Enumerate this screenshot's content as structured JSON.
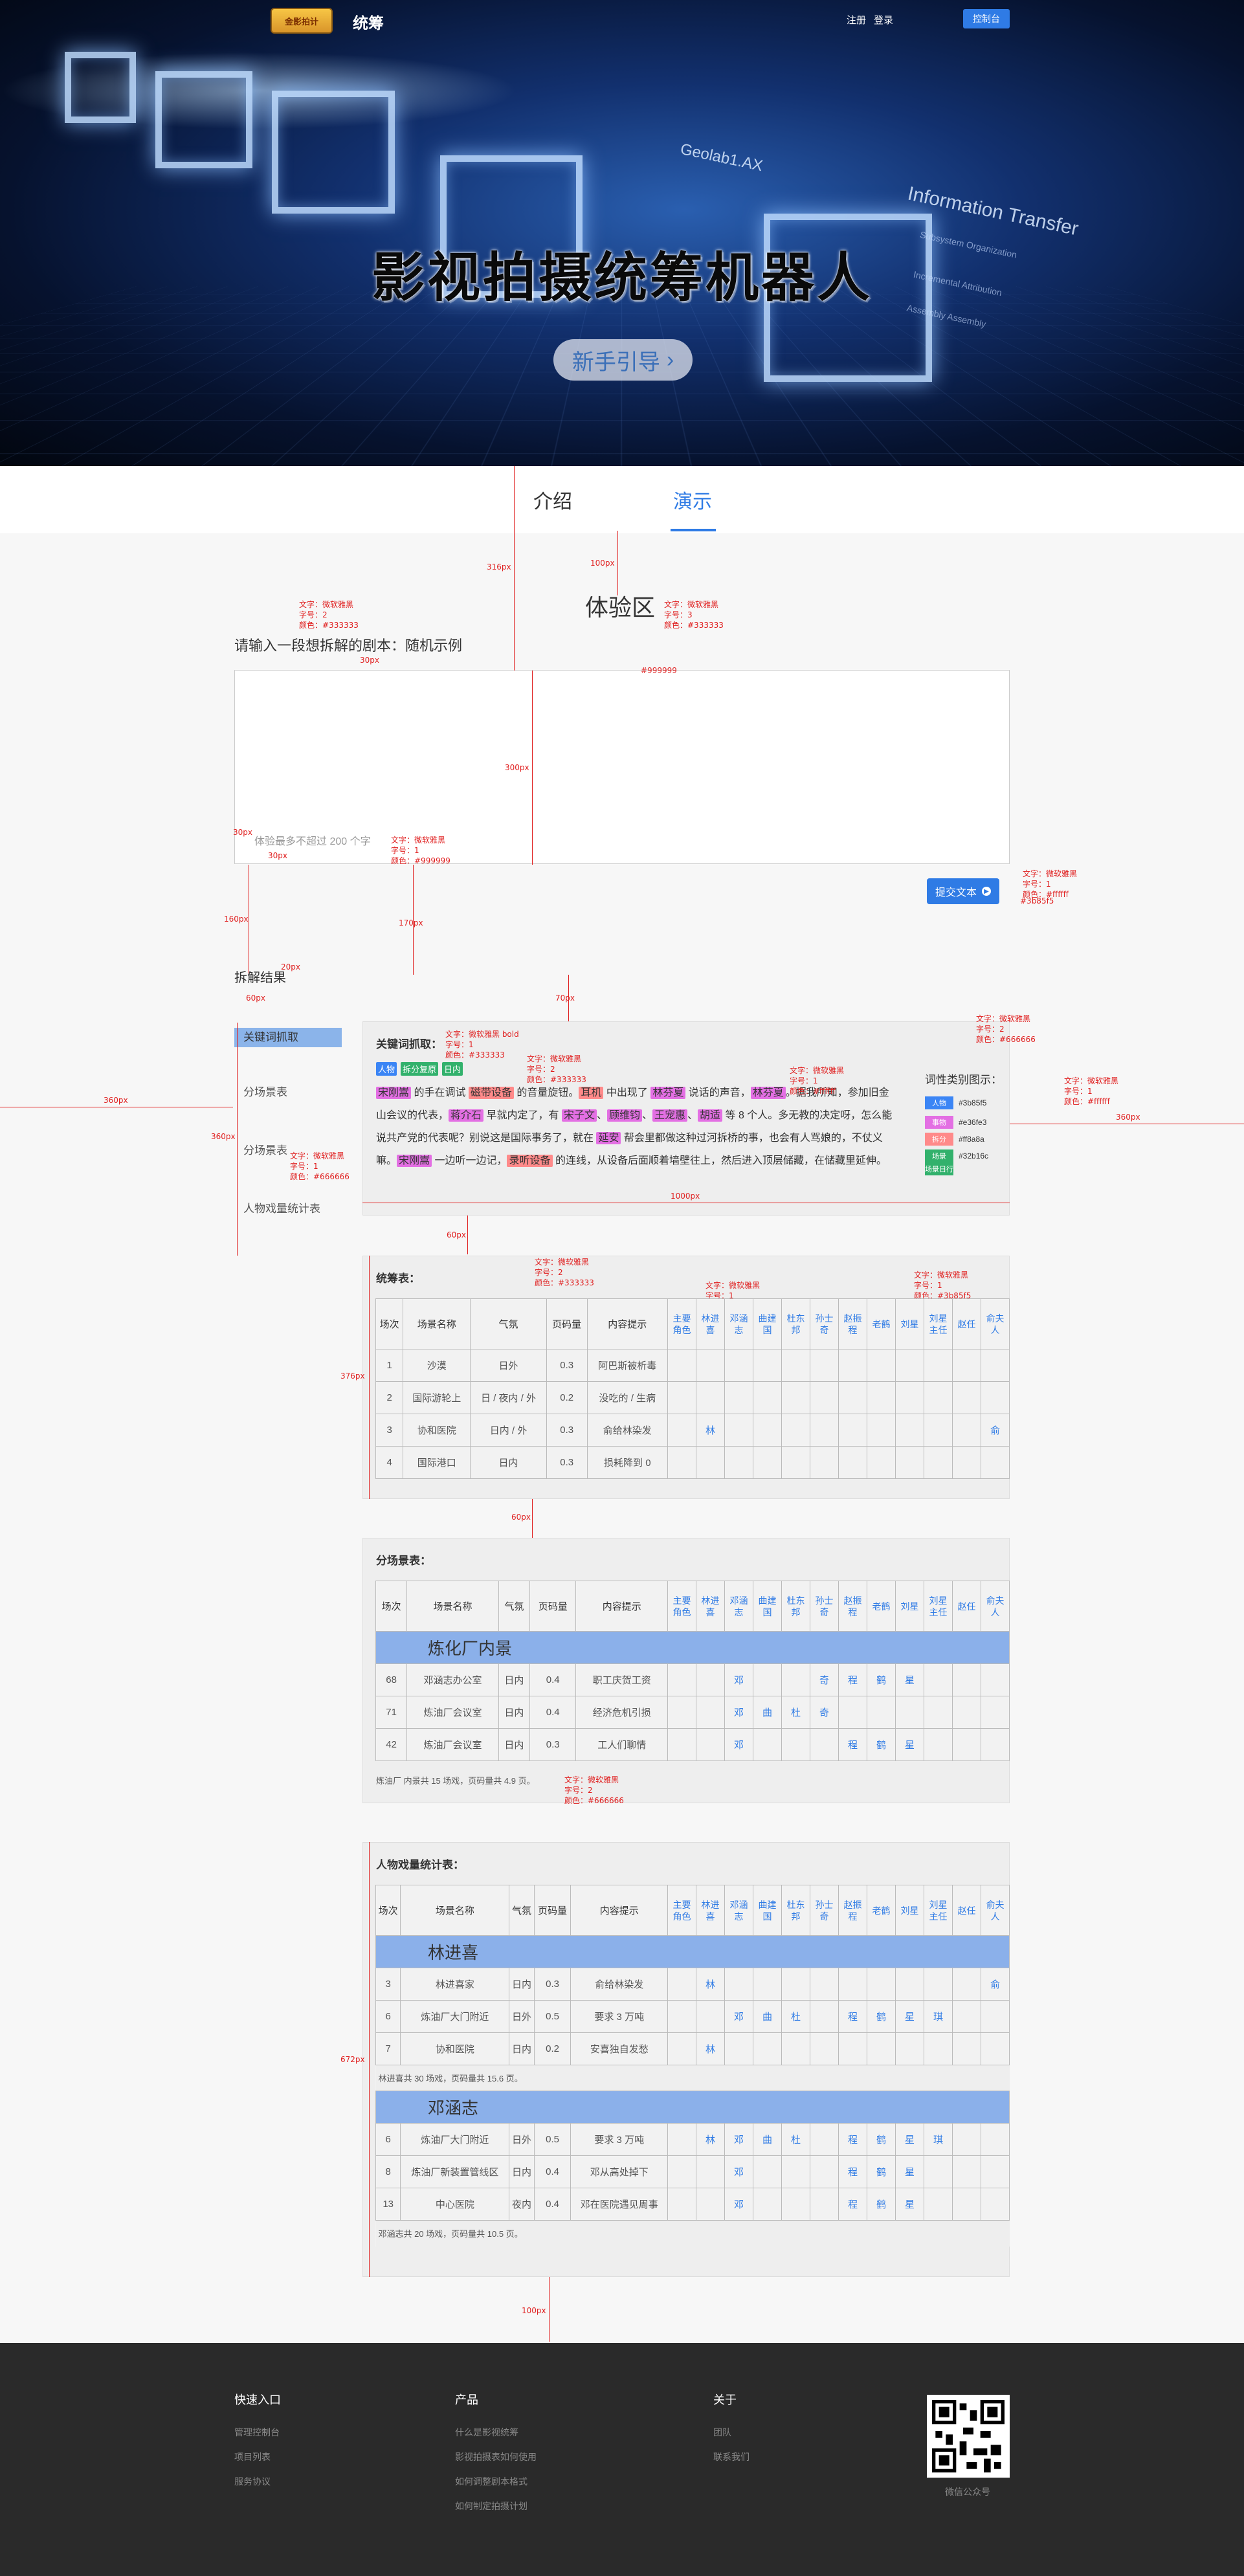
{
  "header": {
    "logo_badge": "金影拍计",
    "brand": "统筹",
    "register": "注册",
    "login": "登录",
    "console": "控制台"
  },
  "hero": {
    "title": "影视拍摄统筹机器人",
    "guide_button": "新手引导",
    "decor_geolab": "Geolab1.AX",
    "decor_info": "Information Transfer",
    "decor_sub1": "Subsystem Organization",
    "decor_sub2": "Incremental Attribution",
    "decor_sub3": "Assembly Assembly"
  },
  "tabs": [
    {
      "label": "介绍",
      "active": false
    },
    {
      "label": "演示",
      "active": true
    }
  ],
  "experience": {
    "title": "体验区",
    "input_label": "请输入一段想拆解的剧本：随机示例",
    "placeholder": "体验最多不超过 200 个字",
    "submit": "提交文本"
  },
  "result": {
    "title": "拆解结果",
    "menu": [
      {
        "label": "关键词抓取",
        "active": true
      },
      {
        "label": "分场景表",
        "active": false
      },
      {
        "label": "分场景表",
        "active": false
      },
      {
        "label": "人物戏量统计表",
        "active": false
      }
    ],
    "kw_card": {
      "title": "关键词抓取：",
      "tags": [
        {
          "text": "人物",
          "color": "#3b85f5"
        },
        {
          "text": "拆分复原",
          "color": "#32b16c"
        },
        {
          "text": "日内",
          "color": "#32b16c"
        }
      ],
      "paragraph_before": "",
      "segments": [
        {
          "text": "宋刚嵩",
          "hl": "#e36fe3"
        },
        {
          "text": " 的手在调试 ",
          "hl": ""
        },
        {
          "text": "磁带设备",
          "hl": "#ff8a8a"
        },
        {
          "text": " 的音量旋钮。",
          "hl": ""
        },
        {
          "text": "耳机",
          "hl": "#ff8a8a"
        },
        {
          "text": " 中出现了 ",
          "hl": ""
        },
        {
          "text": "林芬夏",
          "hl": "#e36fe3"
        },
        {
          "text": " 说话的声音，",
          "hl": ""
        },
        {
          "text": "林芬夏",
          "hl": "#e36fe3"
        },
        {
          "text": "。据我所知，参加旧金山会议的代表，",
          "hl": ""
        },
        {
          "text": "蒋介石",
          "hl": "#e36fe3"
        },
        {
          "text": " 早就内定了，有 ",
          "hl": ""
        },
        {
          "text": "宋子文",
          "hl": "#e36fe3"
        },
        {
          "text": "、",
          "hl": ""
        },
        {
          "text": "顾维钧",
          "hl": "#e36fe3"
        },
        {
          "text": "、",
          "hl": ""
        },
        {
          "text": "王宠惠",
          "hl": "#e36fe3"
        },
        {
          "text": "、",
          "hl": ""
        },
        {
          "text": "胡适",
          "hl": "#e36fe3"
        },
        {
          "text": " 等 8 个人。多无教的决定呀，怎么能说共产党的代表呢？别说这是国际事务了，就在 ",
          "hl": ""
        },
        {
          "text": "延安",
          "hl": "#e36fe3"
        },
        {
          "text": " 帮会里都做这种过河拆桥的事，也会有人骂娘的，不仗义嘛。",
          "hl": ""
        },
        {
          "text": "宋刚嵩",
          "hl": "#e36fe3"
        },
        {
          "text": " 一边听一边记，",
          "hl": ""
        },
        {
          "text": "录听设备",
          "hl": "#ff8a8a"
        },
        {
          "text": " 的连线，从设备后面顺着墙壁往上，然后进入顶层储藏，在储藏里延伸。",
          "hl": ""
        }
      ],
      "legend_title": "词性类别图示：",
      "legend": [
        {
          "chip": "人物",
          "color": "#3b85f5",
          "hex": "#3b85f5"
        },
        {
          "chip": "事物",
          "color": "#e36fe3",
          "hex": "#e36fe3"
        },
        {
          "chip": "拆分",
          "color": "#ff8a8a",
          "hex": "#ff8a8a"
        },
        {
          "chip": "场景",
          "color": "#32b16c",
          "hex": "#32b16c"
        },
        {
          "chip": "场景日行",
          "color": "#32b16c",
          "hex": ""
        }
      ]
    },
    "overall_table": {
      "title": "统筹表：",
      "headers": [
        "场次",
        "场景名称",
        "气氛",
        "页码量",
        "内容提示"
      ],
      "roles": [
        "主要角色",
        "林进喜",
        "邓涵志",
        "曲建国",
        "杜东邦",
        "孙士奇",
        "赵振程",
        "老鹤",
        "刘星",
        "刘星主任",
        "赵任",
        "俞夫人"
      ],
      "rows": [
        {
          "c": [
            "1",
            "沙漠",
            "日外",
            "0.3",
            "阿巴斯被析毒"
          ],
          "r": [
            "",
            "",
            "",
            "",
            "",
            "",
            "",
            "",
            "",
            "",
            "",
            ""
          ]
        },
        {
          "c": [
            "2",
            "国际游轮上",
            "日 / 夜内 / 外",
            "0.2",
            "没吃的 / 生病"
          ],
          "r": [
            "",
            "",
            "",
            "",
            "",
            "",
            "",
            "",
            "",
            "",
            "",
            ""
          ]
        },
        {
          "c": [
            "3",
            "协和医院",
            "日内 / 外",
            "0.3",
            "俞给林染发"
          ],
          "r": [
            "",
            "林",
            "",
            "",
            "",
            "",
            "",
            "",
            "",
            "",
            "",
            "俞"
          ]
        },
        {
          "c": [
            "4",
            "国际港口",
            "日内",
            "0.3",
            "损耗降到 0"
          ],
          "r": [
            "",
            "",
            "",
            "",
            "",
            "",
            "",
            "",
            "",
            "",
            "",
            ""
          ]
        }
      ]
    },
    "scene_table": {
      "title": "分场景表：",
      "group": "炼化厂内景",
      "rows": [
        {
          "c": [
            "68",
            "邓涵志办公室",
            "日内",
            "0.4",
            "职工庆贺工资"
          ],
          "r": [
            "",
            "",
            "邓",
            "",
            "",
            "奇",
            "程",
            "鹤",
            "星",
            "",
            "",
            ""
          ]
        },
        {
          "c": [
            "71",
            "炼油厂会议室",
            "日内",
            "0.4",
            "经济危机引损"
          ],
          "r": [
            "",
            "",
            "邓",
            "曲",
            "杜",
            "奇",
            "",
            "",
            "",
            "",
            "",
            ""
          ]
        },
        {
          "c": [
            "42",
            "炼油厂会议室",
            "日内",
            "0.3",
            "工人们聊情"
          ],
          "r": [
            "",
            "",
            "邓",
            "",
            "",
            "",
            "程",
            "鹤",
            "星",
            "",
            "",
            ""
          ]
        }
      ],
      "summary": "炼油厂 内景共 15 场戏，页码量共 4.9 页。"
    },
    "person_table": {
      "title": "人物戏量统计表：",
      "groups": [
        {
          "name": "林进喜",
          "rows": [
            {
              "c": [
                "3",
                "林进喜家",
                "日内",
                "0.3",
                "俞给林染发"
              ],
              "r": [
                "",
                "林",
                "",
                "",
                "",
                "",
                "",
                "",
                "",
                "",
                "",
                "俞"
              ]
            },
            {
              "c": [
                "6",
                "炼油厂大门附近",
                "日外",
                "0.5",
                "要求 3 万吨"
              ],
              "r": [
                "",
                "",
                "邓",
                "曲",
                "杜",
                "",
                "程",
                "鹤",
                "星",
                "琪",
                "",
                ""
              ]
            },
            {
              "c": [
                "7",
                "协和医院",
                "日内",
                "0.2",
                "安喜独自发愁"
              ],
              "r": [
                "",
                "林",
                "",
                "",
                "",
                "",
                "",
                "",
                "",
                "",
                "",
                ""
              ]
            }
          ],
          "summary": "林进喜共 30 场戏，页码量共 15.6 页。"
        },
        {
          "name": "邓涵志",
          "rows": [
            {
              "c": [
                "6",
                "炼油厂大门附近",
                "日外",
                "0.5",
                "要求 3 万吨"
              ],
              "r": [
                "",
                "林",
                "邓",
                "曲",
                "杜",
                "",
                "程",
                "鹤",
                "星",
                "琪",
                "",
                ""
              ]
            },
            {
              "c": [
                "8",
                "炼油厂新装置管线区",
                "日内",
                "0.4",
                "邓从高处掉下"
              ],
              "r": [
                "",
                "",
                "邓",
                "",
                "",
                "",
                "程",
                "鹤",
                "星",
                "",
                "",
                ""
              ]
            },
            {
              "c": [
                "13",
                "中心医院",
                "夜内",
                "0.4",
                "邓在医院遇见周事"
              ],
              "r": [
                "",
                "",
                "邓",
                "",
                "",
                "",
                "程",
                "鹤",
                "星",
                "",
                "",
                ""
              ]
            }
          ],
          "summary": "邓涵志共 20 场戏，页码量共 10.5 页。"
        }
      ]
    }
  },
  "annotations": {
    "font_a": "文字：微软雅黑\n字号：2\n颜色：#333333",
    "font_b": "文字：微软雅黑\n字号：3\n颜色：#333333",
    "font_c": "文字：微软雅黑\n字号：1\n颜色：#999999",
    "font_d": "文字：微软雅黑\n字号：1\n颜色：#ffffff",
    "font_e": "文字：微软雅黑\n字号：2\n颜色：#666666",
    "font_f": "文字：微软雅黑 bold\n字号：1\n颜色：#333333",
    "font_g": "文字：微软雅黑\n字号：1\n颜色：#3b85f5",
    "font_h": "文字：微软雅黑\n字号：1\n颜色：#666666",
    "sizes": [
      "316px",
      "100px",
      "30px",
      "300px",
      "30px",
      "30px",
      "160px",
      "170px",
      "20px",
      "20px",
      "70px",
      "60px",
      "360px",
      "360px",
      "1000px",
      "60px",
      "376px",
      "114px",
      "70px",
      "60px",
      "672px",
      "400px",
      "100px",
      "66px",
      "34px"
    ],
    "color_999": "#999999",
    "color_3b": "#3b85f5",
    "color_8b": "#8bb0ea"
  },
  "footer": {
    "columns": [
      {
        "title": "快速入口",
        "items": [
          "管理控制台",
          "项目列表",
          "服务协议"
        ]
      },
      {
        "title": "产品",
        "items": [
          "什么是影视统筹",
          "影视拍摄表如何使用",
          "如何调整剧本格式",
          "如何制定拍摄计划"
        ]
      },
      {
        "title": "关于",
        "items": [
          "团队",
          "联系我们"
        ]
      }
    ],
    "qr_caption": "微信公众号"
  }
}
